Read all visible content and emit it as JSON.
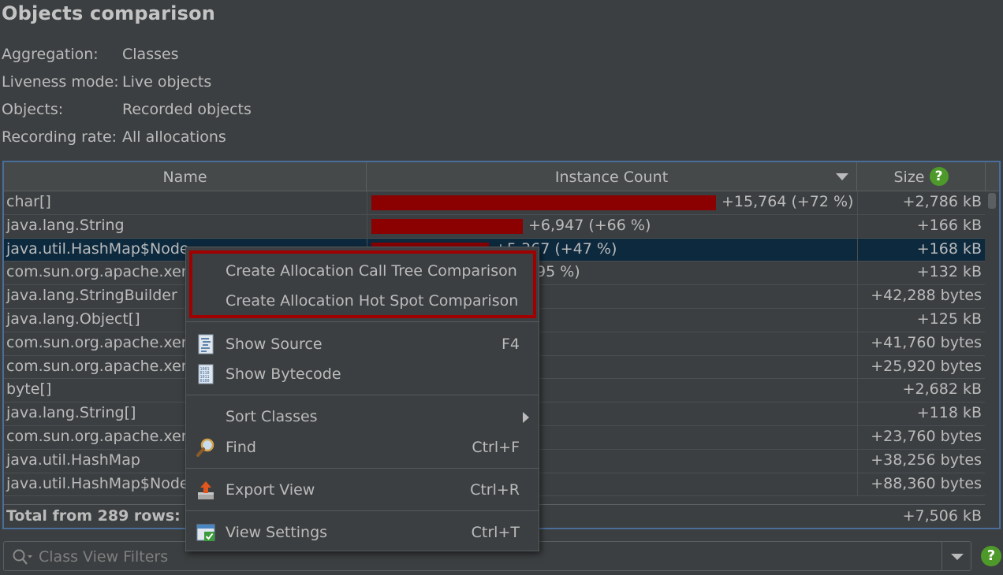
{
  "title": "Objects comparison",
  "info": [
    {
      "label": "Aggregation:",
      "value": "Classes"
    },
    {
      "label": "Liveness mode:",
      "value": "Live objects"
    },
    {
      "label": "Objects:",
      "value": "Recorded objects"
    },
    {
      "label": "Recording rate:",
      "value": "All allocations"
    }
  ],
  "table": {
    "columns": {
      "name": "Name",
      "count": "Instance Count",
      "size": "Size"
    },
    "help_glyph": "?",
    "rows": [
      {
        "name": "char[]",
        "count": "+15,764 (+72 %)",
        "size": "+2,786 kB",
        "bar_fraction": 1.0
      },
      {
        "name": "java.lang.String",
        "count": "+6,947 (+66 %)",
        "size": "+166 kB",
        "bar_fraction": 0.44
      },
      {
        "name": "java.util.HashMap$Node",
        "count": "+5,367 (+47 %)",
        "size": "+168 kB",
        "bar_fraction": 0.34
      },
      {
        "name": "com.sun.org.apache.xerc",
        "count": "95 %)",
        "size": "+132 kB",
        "bar_fraction": 0.0
      },
      {
        "name": "java.lang.StringBuilder",
        "count": "",
        "size": "+42,288 bytes",
        "bar_fraction": 0.0
      },
      {
        "name": "java.lang.Object[]",
        "count": "",
        "size": "+125 kB",
        "bar_fraction": 0.0
      },
      {
        "name": "com.sun.org.apache.xerc",
        "count": "",
        "size": "+41,760 bytes",
        "bar_fraction": 0.0
      },
      {
        "name": "com.sun.org.apache.xerc",
        "count": "",
        "size": "+25,920 bytes",
        "bar_fraction": 0.0
      },
      {
        "name": "byte[]",
        "count": "",
        "size": "+2,682 kB",
        "bar_fraction": 0.0
      },
      {
        "name": "java.lang.String[]",
        "count": "",
        "size": "+118 kB",
        "bar_fraction": 0.0
      },
      {
        "name": "com.sun.org.apache.xerc",
        "count": "",
        "size": "+23,760 bytes",
        "bar_fraction": 0.0
      },
      {
        "name": "java.util.HashMap",
        "count": "",
        "size": "+38,256 bytes",
        "bar_fraction": 0.0
      },
      {
        "name": "java.util.HashMap$Node",
        "count": "",
        "size": "+88,360 bytes",
        "bar_fraction": 0.0
      }
    ],
    "selected_row": 2,
    "total_label": "Total from 289 rows:",
    "total_size": "+7,506 kB"
  },
  "filter": {
    "placeholder": "Class View Filters"
  },
  "menu": {
    "items": [
      {
        "label": "Create Allocation Call Tree Comparison",
        "shortcut": "",
        "icon": ""
      },
      {
        "label": "Create Allocation Hot Spot Comparison",
        "shortcut": "",
        "icon": ""
      },
      {
        "label": "Show Source",
        "shortcut": "F4",
        "icon": "source-file-icon"
      },
      {
        "label": "Show Bytecode",
        "shortcut": "",
        "icon": "bytecode-icon"
      },
      {
        "label": "Sort Classes",
        "shortcut": "",
        "icon": ""
      },
      {
        "label": "Find",
        "shortcut": "Ctrl+F",
        "icon": "magnifier-icon"
      },
      {
        "label": "Export View",
        "shortcut": "Ctrl+R",
        "icon": "export-icon"
      },
      {
        "label": "View Settings",
        "shortcut": "Ctrl+T",
        "icon": "view-settings-icon"
      }
    ]
  },
  "colors": {
    "background": "#3c3f41",
    "bar": "#8b0000",
    "selection": "#0d293e",
    "highlight_border": "#a00000",
    "help_green": "#4d9a2a",
    "table_border": "#4a6e9a"
  }
}
